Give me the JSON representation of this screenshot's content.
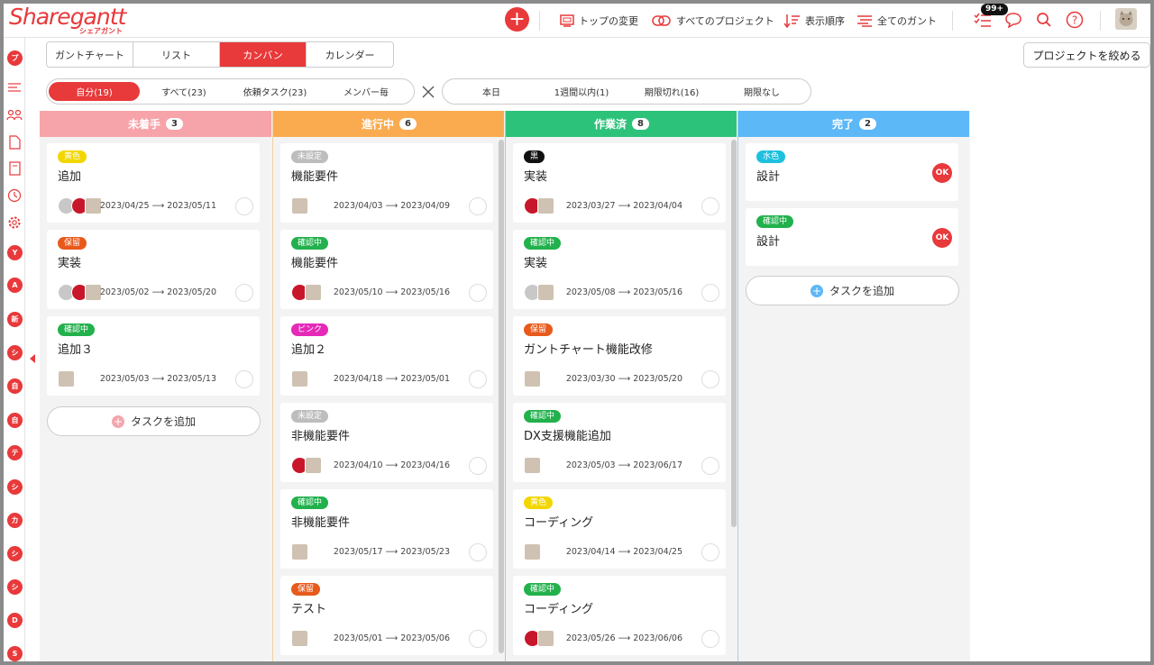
{
  "app": {
    "logo": "Sharegantt",
    "logo_sub": "シェアガント"
  },
  "header": {
    "nav": [
      {
        "label": "トップの変更",
        "icon": "top-change-icon"
      },
      {
        "label": "すべてのプロジェクト",
        "icon": "all-projects-icon"
      },
      {
        "label": "表示順序",
        "icon": "sort-order-icon"
      },
      {
        "label": "全てのガント",
        "icon": "all-gantt-icon"
      }
    ],
    "badge": "99+"
  },
  "sidebar": {
    "projects": [
      "プ",
      "Y",
      "A",
      "新",
      "シ",
      "自",
      "自",
      "テ",
      "シ",
      "カ",
      "シ",
      "シ",
      "D",
      "S"
    ]
  },
  "tabs": [
    "ガントチャート",
    "リスト",
    "カンバン",
    "カレンダー"
  ],
  "active_tab": 2,
  "project_button": "プロジェクトを絞める",
  "filter_owner": [
    "自分(19)",
    "すべて(23)",
    "依頼タスク(23)",
    "メンバー毎"
  ],
  "filter_due": [
    "本日",
    "1週間以内(1)",
    "期限切れ(16)",
    "期限なし"
  ],
  "add_task_label": "タスクを追加",
  "colors": {
    "accent": "#e8393b"
  },
  "columns": [
    {
      "title": "未着手",
      "count": "3",
      "color": "#f7a3aa",
      "cards": [
        {
          "tag": "黄色",
          "tag_color": "#f2d600",
          "title": "追加",
          "dates": "2023/04/25 ⟶ 2023/05/11",
          "avatars": [
            "gray",
            "red",
            "cat"
          ]
        },
        {
          "tag": "保留",
          "tag_color": "#e85a1c",
          "title": "実装",
          "dates": "2023/05/02 ⟶ 2023/05/20",
          "avatars": [
            "gray",
            "red",
            "cat"
          ]
        },
        {
          "tag": "確認中",
          "tag_color": "#22b14c",
          "title": "追加３",
          "dates": "2023/05/03 ⟶ 2023/05/13",
          "avatars": [
            "cat"
          ]
        }
      ]
    },
    {
      "title": "進行中",
      "count": "6",
      "color": "#fbab4f",
      "cards": [
        {
          "tag": "未設定",
          "tag_color": "#bdbdbd",
          "title": "機能要件",
          "dates": "2023/04/03 ⟶ 2023/04/09",
          "avatars": [
            "cat"
          ]
        },
        {
          "tag": "確認中",
          "tag_color": "#22b14c",
          "title": "機能要件",
          "dates": "2023/05/10 ⟶ 2023/05/16",
          "avatars": [
            "red",
            "cat"
          ]
        },
        {
          "tag": "ピンク",
          "tag_color": "#e529b8",
          "title": "追加２",
          "dates": "2023/04/18 ⟶ 2023/05/01",
          "avatars": [
            "cat"
          ]
        },
        {
          "tag": "未設定",
          "tag_color": "#bdbdbd",
          "title": "非機能要件",
          "dates": "2023/04/10 ⟶ 2023/04/16",
          "avatars": [
            "red",
            "cat"
          ]
        },
        {
          "tag": "確認中",
          "tag_color": "#22b14c",
          "title": "非機能要件",
          "dates": "2023/05/17 ⟶ 2023/05/23",
          "avatars": [
            "cat"
          ]
        },
        {
          "tag": "保留",
          "tag_color": "#e85a1c",
          "title": "テスト",
          "dates": "2023/05/01 ⟶ 2023/05/06",
          "avatars": [
            "cat"
          ]
        }
      ]
    },
    {
      "title": "作業済",
      "count": "8",
      "color": "#2dc27a",
      "cards": [
        {
          "tag": "黒",
          "tag_color": "#111111",
          "title": "実装",
          "dates": "2023/03/27 ⟶ 2023/04/04",
          "avatars": [
            "red",
            "cat"
          ]
        },
        {
          "tag": "確認中",
          "tag_color": "#22b14c",
          "title": "実装",
          "dates": "2023/05/08 ⟶ 2023/05/16",
          "avatars": [
            "gray",
            "cat"
          ]
        },
        {
          "tag": "保留",
          "tag_color": "#e85a1c",
          "title": "ガントチャート機能改修",
          "dates": "2023/03/30 ⟶ 2023/05/20",
          "avatars": [
            "cat"
          ]
        },
        {
          "tag": "確認中",
          "tag_color": "#22b14c",
          "title": "DX支援機能追加",
          "dates": "2023/05/03 ⟶ 2023/06/17",
          "avatars": [
            "cat"
          ]
        },
        {
          "tag": "黄色",
          "tag_color": "#f2d600",
          "title": "コーディング",
          "dates": "2023/04/14 ⟶ 2023/04/25",
          "avatars": [
            "cat"
          ]
        },
        {
          "tag": "確認中",
          "tag_color": "#22b14c",
          "title": "コーディング",
          "dates": "2023/05/26 ⟶ 2023/06/06",
          "avatars": [
            "red",
            "cat"
          ]
        }
      ]
    },
    {
      "title": "完了",
      "count": "2",
      "color": "#5db8f7",
      "cards": [
        {
          "tag": "水色",
          "tag_color": "#1ec0de",
          "title": "設計",
          "ok": "OK"
        },
        {
          "tag": "確認中",
          "tag_color": "#22b14c",
          "title": "設計",
          "ok": "OK"
        }
      ]
    }
  ]
}
